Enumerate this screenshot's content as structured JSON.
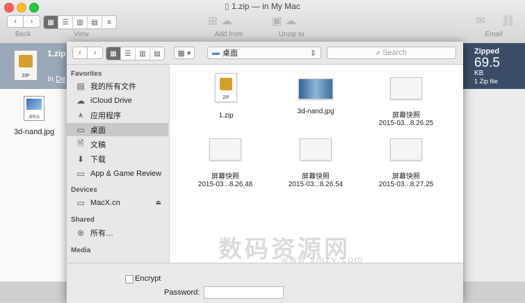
{
  "window": {
    "title": "1.zip — in My Mac",
    "toolbar": {
      "back_label": "Back",
      "view_label": "View",
      "add_from_label": "Add from",
      "unzip_to_label": "Unzip to",
      "email_label": "Email"
    }
  },
  "archive": {
    "name": "1.zip",
    "in_prefix": "In",
    "in_location": "De",
    "status": "Zipped",
    "size_value": "69.5",
    "size_unit": "KB",
    "file_count": "1 Zip file",
    "item_name": "3d-nand.jpg",
    "item_type_badge": "JPEG"
  },
  "sheet": {
    "location": "桌面",
    "search_placeholder": "Search",
    "sidebar": {
      "favorites_heading": "Favorites",
      "favorites": [
        {
          "label": "我的所有文件",
          "icon": "all-files-icon"
        },
        {
          "label": "iCloud Drive",
          "icon": "cloud-icon"
        },
        {
          "label": "应用程序",
          "icon": "applications-icon"
        },
        {
          "label": "桌面",
          "icon": "desktop-icon"
        },
        {
          "label": "文稿",
          "icon": "documents-icon"
        },
        {
          "label": "下载",
          "icon": "downloads-icon"
        },
        {
          "label": "App & Game Review",
          "icon": "folder-icon"
        }
      ],
      "devices_heading": "Devices",
      "devices": [
        {
          "label": "MacX.cn",
          "icon": "disk-icon"
        }
      ],
      "shared_heading": "Shared",
      "shared": [
        {
          "label": "所有…",
          "icon": "network-icon"
        }
      ],
      "media_heading": "Media"
    },
    "files": [
      {
        "line1": "1.zip",
        "line2": ""
      },
      {
        "line1": "3d-nand.jpg",
        "line2": ""
      },
      {
        "line1": "屏幕快照",
        "line2": "2015-03...8.26.25"
      },
      {
        "line1": "屏幕快照",
        "line2": "2015-03...8.26.48"
      },
      {
        "line1": "屏幕快照",
        "line2": "2015-03...8.26.54"
      },
      {
        "line1": "屏幕快照",
        "line2": "2015-03...8.27.25"
      }
    ],
    "encrypt_label": "Encrypt",
    "password_label": "Password:",
    "password_value": ""
  },
  "watermark": {
    "text": "数码资源网",
    "url": "www.smzy.com"
  }
}
